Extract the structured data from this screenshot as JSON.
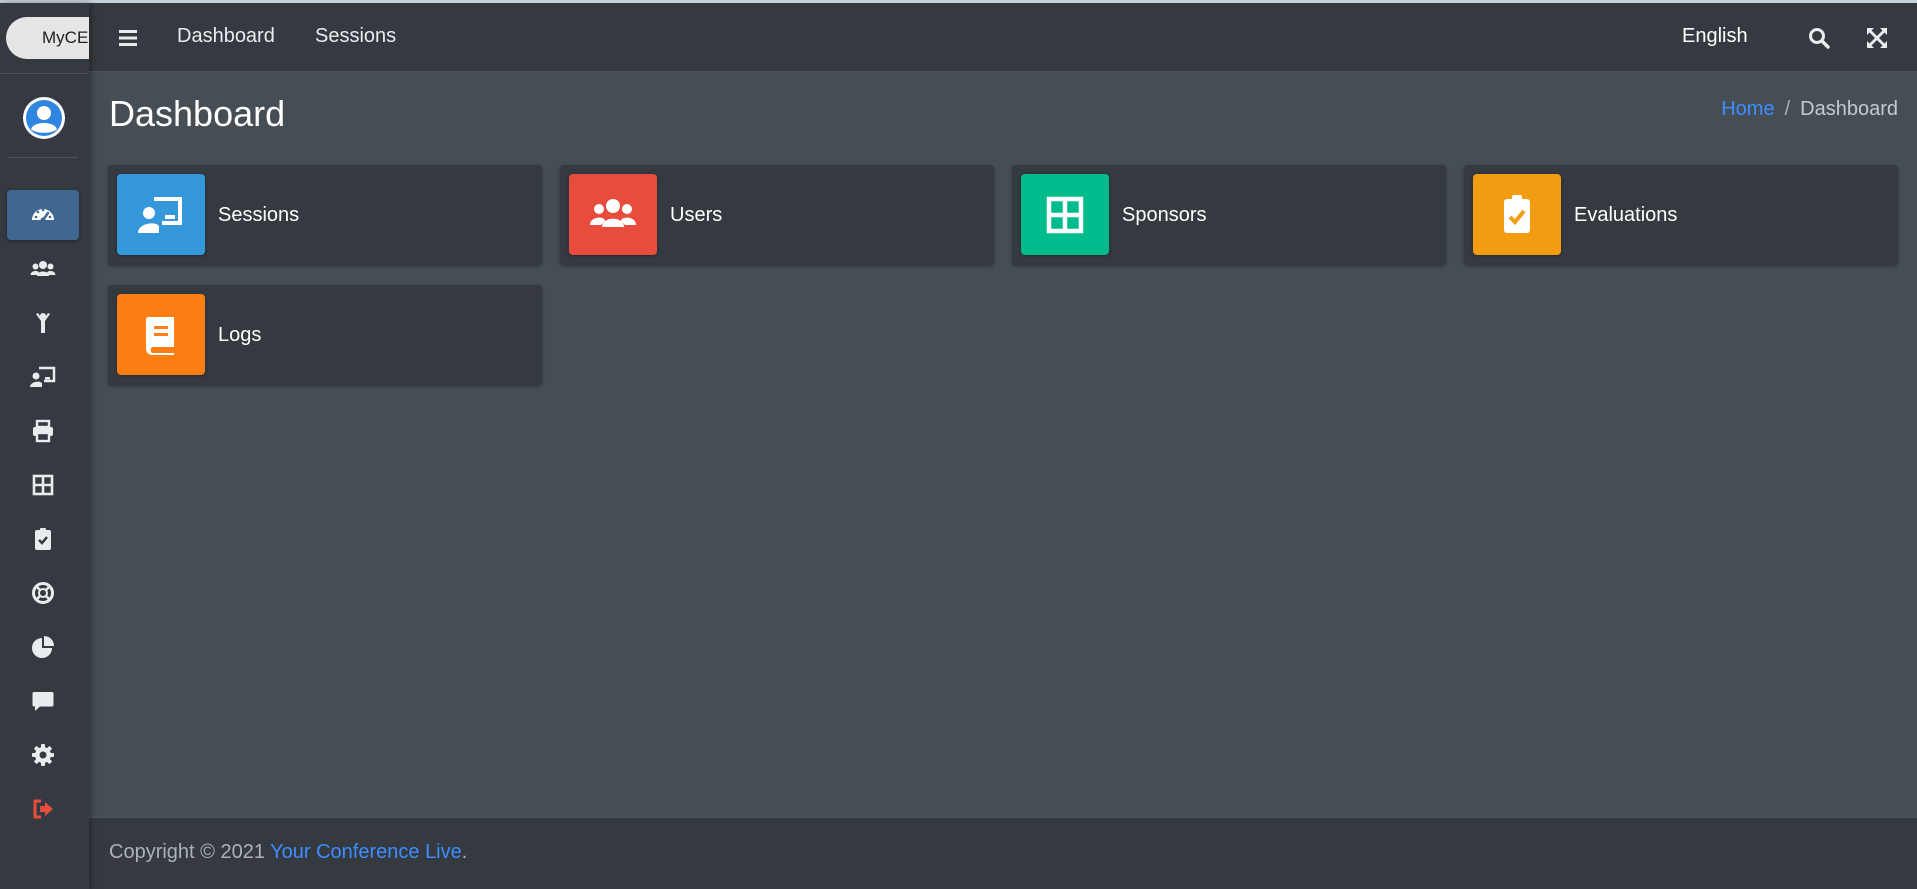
{
  "brand": {
    "text": "MyCE"
  },
  "header": {
    "nav": [
      {
        "label": "Dashboard"
      },
      {
        "label": "Sessions"
      }
    ],
    "language": "English"
  },
  "page": {
    "title": "Dashboard",
    "breadcrumb": {
      "home": "Home",
      "separator": "/",
      "current": "Dashboard"
    }
  },
  "boxes": [
    {
      "label": "Sessions",
      "icon": "presentation-icon",
      "color": "#3498db"
    },
    {
      "label": "Users",
      "icon": "users-icon",
      "color": "#e74c3c"
    },
    {
      "label": "Sponsors",
      "icon": "grid-icon",
      "color": "#00bc8c"
    },
    {
      "label": "Evaluations",
      "icon": "clipboard-check-icon",
      "color": "#f39c12"
    },
    {
      "label": "Logs",
      "icon": "book-icon",
      "color": "#fd7e14"
    }
  ],
  "sidebar": {
    "items": [
      {
        "icon": "dashboard-gauge-icon",
        "active": true
      },
      {
        "icon": "users-icon"
      },
      {
        "icon": "person-arms-up-icon"
      },
      {
        "icon": "presentation-icon"
      },
      {
        "icon": "print-icon"
      },
      {
        "icon": "grid-icon"
      },
      {
        "icon": "clipboard-check-icon"
      },
      {
        "icon": "life-ring-icon"
      },
      {
        "icon": "pie-chart-icon"
      },
      {
        "icon": "comment-icon"
      },
      {
        "icon": "gear-icon"
      },
      {
        "icon": "sign-out-icon",
        "color": "#e74c3c"
      }
    ]
  },
  "footer": {
    "prefix": "Copyright © 2021 ",
    "link": "Your Conference Live",
    "suffix": "."
  },
  "colors": {
    "active_nav": "#3f6791",
    "link": "#3f8cff",
    "panel": "#343a40",
    "background": "#454d55"
  }
}
